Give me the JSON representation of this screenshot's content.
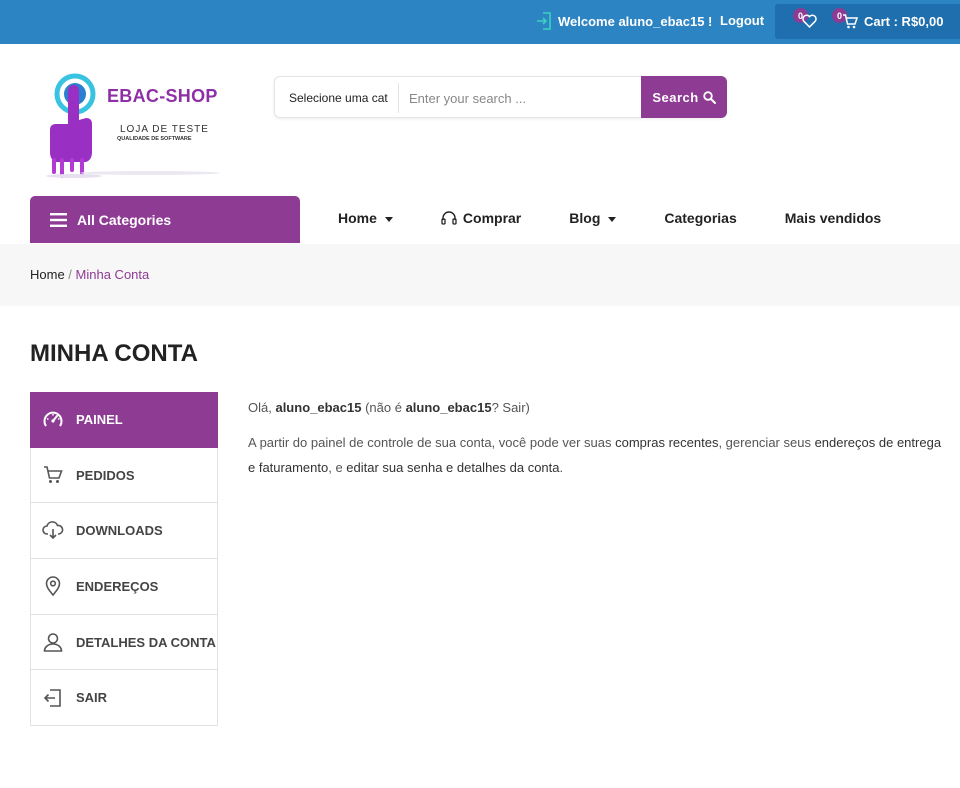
{
  "topbar": {
    "welcome": "Welcome aluno_ebac15 !",
    "logout": "Logout",
    "wishlist_count": "0",
    "cart_count": "0",
    "cart_label": "Cart : R$0,00"
  },
  "logo": {
    "brand": "EBAC-SHOP",
    "tagline": "LOJA DE TESTE",
    "subtagline": "QUALIDADE DE SOFTWARE"
  },
  "search": {
    "category_select": "Selecione uma cat",
    "placeholder": "Enter your search ...",
    "button_label": "Search"
  },
  "nav": {
    "all_categories": "All Categories",
    "items": [
      {
        "label": "Home",
        "dropdown": true
      },
      {
        "label": "Comprar",
        "icon": "headset-icon"
      },
      {
        "label": "Blog",
        "dropdown": true
      },
      {
        "label": "Categorias"
      },
      {
        "label": "Mais vendidos"
      }
    ]
  },
  "breadcrumb": {
    "home": "Home",
    "separator": " / ",
    "current": "Minha Conta"
  },
  "page": {
    "title": "MINHA CONTA"
  },
  "account_nav": {
    "items": [
      {
        "label": "PAINEL",
        "icon": "dashboard-icon",
        "active": true
      },
      {
        "label": "PEDIDOS",
        "icon": "cart-icon"
      },
      {
        "label": "DOWNLOADS",
        "icon": "cloud-download-icon"
      },
      {
        "label": "ENDEREÇOS",
        "icon": "location-pin-icon"
      },
      {
        "label": "DETALHES DA CONTA",
        "icon": "user-icon"
      },
      {
        "label": "SAIR",
        "icon": "logout-icon"
      }
    ]
  },
  "dashboard": {
    "hello_prefix": "Olá, ",
    "username": "aluno_ebac15",
    "not_you_prefix": " (não é ",
    "not_you_user": "aluno_ebac15",
    "not_you_suffix": "? ",
    "logout_link": "Sair",
    "close_paren": ")",
    "line1_a": "A partir do painel de controle de sua conta, você pode ver suas ",
    "recent_orders_link": "compras recentes",
    "line1_b": ", gerenciar seus ",
    "addresses_link": "endereços de entrega",
    "line2_a": "e faturamento",
    "line2_b": ", e ",
    "edit_link": "editar sua senha e detalhes da conta",
    "line2_end": "."
  },
  "colors": {
    "topbar": "#2c84c3",
    "accent_purple": "#8e3b93",
    "brand_purple": "#8e2fa7"
  }
}
